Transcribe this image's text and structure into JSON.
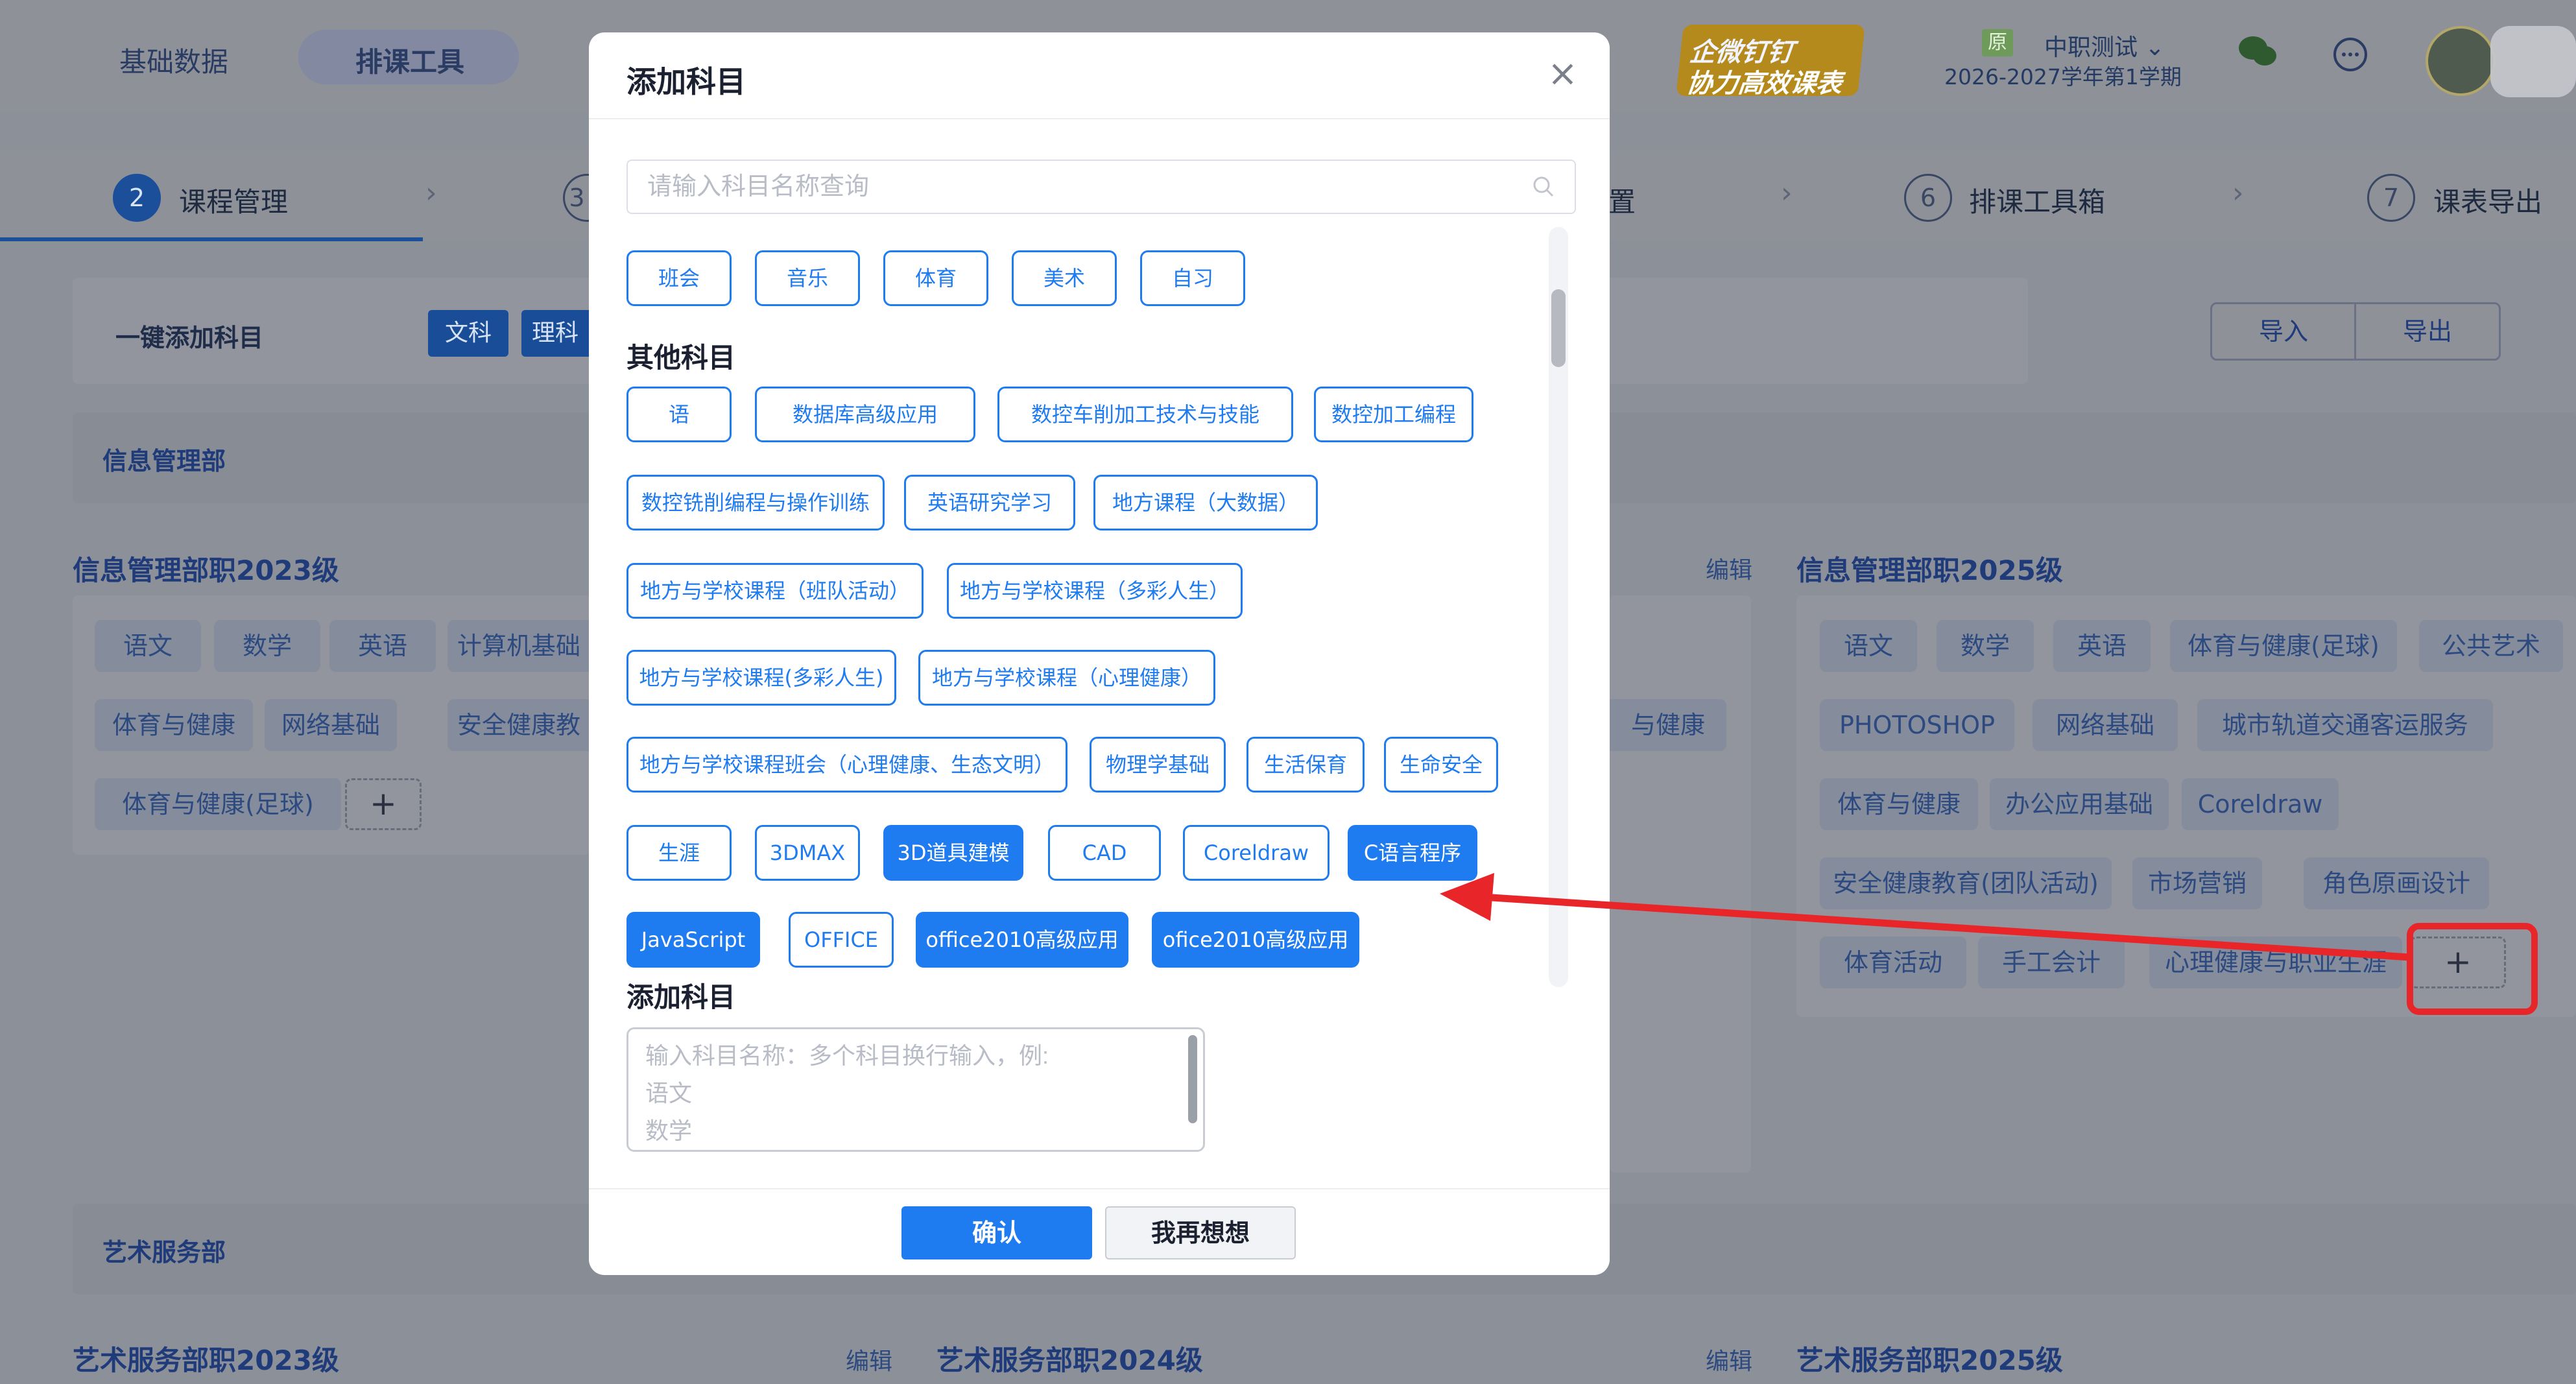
{
  "header": {
    "nav_basic": "基础数据",
    "nav_schedule": "排课工具",
    "logo_line1": "企微钉钉",
    "logo_line2": "协力高效课表",
    "badge_yuan": "原",
    "org_name": "中职测试",
    "term": "2026-2027学年第1学期"
  },
  "steps": [
    {
      "num": "2",
      "label": "课程管理"
    },
    {
      "num": "3",
      "label": ""
    },
    {
      "num": "",
      "label": "置"
    },
    {
      "num": "6",
      "label": "排课工具箱"
    },
    {
      "num": "7",
      "label": "课表导出"
    }
  ],
  "toolbar": {
    "quick_add": "一键添加科目",
    "tag_wenke": "文科",
    "tag_like": "理科",
    "import": "导入",
    "export": "导出"
  },
  "background": {
    "dept1": "信息管理部",
    "dept2": "艺术服务部",
    "edit": "编辑",
    "edit_small": "编辑",
    "card_2023": {
      "title": "信息管理部职2023级",
      "tags": [
        "语文",
        "数学",
        "英语",
        "计算机基础",
        "体育与健康",
        "网络基础",
        "安全健康教",
        "体育与健康(足球)"
      ]
    },
    "mid_tag": "与健康",
    "card_2025": {
      "title": "信息管理部职2025级",
      "tags": [
        "语文",
        "数学",
        "英语",
        "体育与健康(足球)",
        "公共艺术",
        "PHOTOSHOP",
        "网络基础",
        "城市轨道交通客运服务",
        "体育与健康",
        "办公应用基础",
        "Coreldraw",
        "安全健康教育(团队活动)",
        "市场营销",
        "角色原画设计",
        "体育活动",
        "手工会计",
        "心理健康与职业生涯"
      ]
    },
    "art_2023": "艺术服务部职2023级",
    "art_2024": "艺术服务部职2024级",
    "art_2025": "艺术服务部职2025级"
  },
  "modal": {
    "title": "添加科目",
    "close_symbol": "×",
    "search_placeholder": "请输入科目名称查询",
    "top_row": [
      "班会",
      "音乐",
      "体育",
      "美术",
      "自习"
    ],
    "other_title": "其他科目",
    "other_subjects": [
      {
        "label": "语",
        "selected": false
      },
      {
        "label": "数据库高级应用",
        "selected": false
      },
      {
        "label": "数控车削加工技术与技能",
        "selected": false
      },
      {
        "label": "数控加工编程",
        "selected": false
      },
      {
        "label": "数控铣削编程与操作训练",
        "selected": false
      },
      {
        "label": "英语研究学习",
        "selected": false
      },
      {
        "label": "地方课程（大数据）",
        "selected": false
      },
      {
        "label": "地方与学校课程（班队活动）",
        "selected": false
      },
      {
        "label": "地方与学校课程（多彩人生）",
        "selected": false
      },
      {
        "label": "地方与学校课程(多彩人生)",
        "selected": false
      },
      {
        "label": "地方与学校课程（心理健康）",
        "selected": false
      },
      {
        "label": "地方与学校课程班会（心理健康、生态文明）",
        "selected": false
      },
      {
        "label": "物理学基础",
        "selected": false
      },
      {
        "label": "生活保育",
        "selected": false
      },
      {
        "label": "生命安全",
        "selected": false
      },
      {
        "label": "生涯",
        "selected": false
      },
      {
        "label": "3DMAX",
        "selected": false
      },
      {
        "label": "3D道具建模",
        "selected": true
      },
      {
        "label": "CAD",
        "selected": false
      },
      {
        "label": "Coreldraw",
        "selected": false
      },
      {
        "label": "C语言程序",
        "selected": true
      },
      {
        "label": "JavaScript",
        "selected": true
      },
      {
        "label": "OFFICE",
        "selected": false
      },
      {
        "label": "office2010高级应用",
        "selected": true
      },
      {
        "label": "ofice2010高级应用",
        "selected": true
      }
    ],
    "add_title": "添加科目",
    "add_placeholder": "输入科目名称：多个科目换行输入，例:\n语文\n数学",
    "confirm": "确认",
    "cancel": "我再想想"
  },
  "add_plus": "+",
  "colors": {
    "primary": "#1f7bf0",
    "annotation": "#e8262a"
  }
}
